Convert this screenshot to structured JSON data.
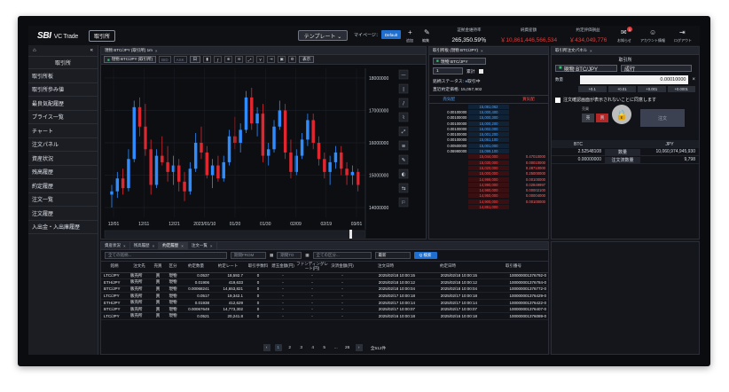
{
  "header": {
    "logo": "SBI",
    "logo_sub": "VC Trade",
    "mode_label": "取引所",
    "template_label": "テンプレート ⌄",
    "myseat_label": "マイページ：",
    "default_label": "Default",
    "add_label": "追加",
    "edit_label": "編集",
    "stats": [
      {
        "title": "証拠金維持率",
        "value": "265,350.59％",
        "color": "#ffffff"
      },
      {
        "title": "純資産額",
        "value": "￥10,861,446,566,534",
        "color": "#e23b3b"
      },
      {
        "title": "約定評価損益",
        "value": "￥434,049,776",
        "color": "#e23b3b"
      }
    ],
    "notice_label": "お知らせ",
    "notice_badge": "1",
    "account_label": "アカウント情報",
    "logout_label": "ログアウト"
  },
  "sidebar": {
    "title": "取引所",
    "items": [
      "取引所板",
      "取引所歩み値",
      "最良気配履歴",
      "プライス一覧",
      "チャート",
      "注文パネル",
      "資産状況",
      "残高履歴",
      "約定履歴",
      "注文一覧",
      "注文履歴",
      "入出金・入出庫履歴"
    ]
  },
  "chart_panel": {
    "tab": "現物 BTC/JPY (取引所) 1m",
    "pair": "現物 BTC/JPY (取引所)",
    "bid": "BID",
    "ask": "ASK",
    "interval": "日",
    "display": "表示"
  },
  "chart_data": {
    "type": "candlestick",
    "x_ticks": [
      "12/01",
      "12/11",
      "12/21",
      "2023/01/10",
      "01/20",
      "01/30",
      "02/09",
      "02/19",
      "03/01"
    ],
    "y_ticks": [
      18000000,
      17000000,
      16000000,
      15000000,
      14000000
    ],
    "ylim": [
      13700000,
      18300000
    ],
    "up_color": "#2f8cff",
    "down_color": "#e0272f",
    "candles": [
      {
        "o": 14400000,
        "h": 14700000,
        "l": 14000000,
        "c": 14500000
      },
      {
        "o": 14500000,
        "h": 15100000,
        "l": 14300000,
        "c": 14900000
      },
      {
        "o": 14900000,
        "h": 15200000,
        "l": 14400000,
        "c": 14600000
      },
      {
        "o": 14600000,
        "h": 15800000,
        "l": 14500000,
        "c": 15500000
      },
      {
        "o": 15500000,
        "h": 17300000,
        "l": 15400000,
        "c": 17100000
      },
      {
        "o": 17100000,
        "h": 17400000,
        "l": 16200000,
        "c": 16500000
      },
      {
        "o": 16500000,
        "h": 17200000,
        "l": 15600000,
        "c": 15800000
      },
      {
        "o": 15800000,
        "h": 16100000,
        "l": 14400000,
        "c": 14700000
      },
      {
        "o": 14700000,
        "h": 15800000,
        "l": 14600000,
        "c": 15600000
      },
      {
        "o": 15600000,
        "h": 16200000,
        "l": 15300000,
        "c": 15400000
      },
      {
        "o": 15400000,
        "h": 15900000,
        "l": 14800000,
        "c": 15100000
      },
      {
        "o": 15100000,
        "h": 15600000,
        "l": 14700000,
        "c": 15300000
      },
      {
        "o": 15300000,
        "h": 15500000,
        "l": 14500000,
        "c": 14800000
      },
      {
        "o": 14800000,
        "h": 15100000,
        "l": 14200000,
        "c": 14500000
      },
      {
        "o": 14500000,
        "h": 15400000,
        "l": 14400000,
        "c": 15200000
      },
      {
        "o": 15200000,
        "h": 16300000,
        "l": 15100000,
        "c": 16000000
      },
      {
        "o": 16000000,
        "h": 16500000,
        "l": 15500000,
        "c": 15700000
      },
      {
        "o": 15700000,
        "h": 15900000,
        "l": 14900000,
        "c": 15000000
      },
      {
        "o": 15000000,
        "h": 15500000,
        "l": 14600000,
        "c": 15300000
      },
      {
        "o": 15300000,
        "h": 15600000,
        "l": 14800000,
        "c": 14900000
      },
      {
        "o": 14900000,
        "h": 15600000,
        "l": 14800000,
        "c": 15400000
      },
      {
        "o": 15400000,
        "h": 16400000,
        "l": 15300000,
        "c": 16200000
      },
      {
        "o": 16200000,
        "h": 16800000,
        "l": 15800000,
        "c": 16000000
      },
      {
        "o": 16000000,
        "h": 16600000,
        "l": 15700000,
        "c": 16400000
      },
      {
        "o": 16400000,
        "h": 17600000,
        "l": 16300000,
        "c": 17400000
      },
      {
        "o": 17400000,
        "h": 17700000,
        "l": 16400000,
        "c": 16600000
      },
      {
        "o": 16600000,
        "h": 17100000,
        "l": 16200000,
        "c": 16900000
      },
      {
        "o": 16900000,
        "h": 17200000,
        "l": 15400000,
        "c": 15600000
      },
      {
        "o": 15600000,
        "h": 16000000,
        "l": 15300000,
        "c": 15800000
      },
      {
        "o": 15800000,
        "h": 16700000,
        "l": 15700000,
        "c": 16500000
      },
      {
        "o": 16500000,
        "h": 17300000,
        "l": 16400000,
        "c": 17000000
      },
      {
        "o": 17000000,
        "h": 17200000,
        "l": 15500000,
        "c": 15700000
      },
      {
        "o": 15700000,
        "h": 16100000,
        "l": 14900000,
        "c": 15100000
      },
      {
        "o": 15100000,
        "h": 15800000,
        "l": 15000000,
        "c": 15600000
      },
      {
        "o": 15600000,
        "h": 16300000,
        "l": 15500000,
        "c": 16100000
      },
      {
        "o": 16100000,
        "h": 16900000,
        "l": 15900000,
        "c": 16700000
      },
      {
        "o": 16700000,
        "h": 16900000,
        "l": 15800000,
        "c": 16000000
      },
      {
        "o": 16000000,
        "h": 16200000,
        "l": 15300000,
        "c": 15500000
      },
      {
        "o": 15500000,
        "h": 15700000,
        "l": 14900000,
        "c": 15100000
      },
      {
        "o": 15100000,
        "h": 15600000,
        "l": 14700000,
        "c": 15400000
      },
      {
        "o": 15400000,
        "h": 15900000,
        "l": 15200000,
        "c": 15700000
      },
      {
        "o": 15700000,
        "h": 15900000,
        "l": 15000000,
        "c": 15200000
      },
      {
        "o": 15200000,
        "h": 15400000,
        "l": 14700000,
        "c": 15000000
      },
      {
        "o": 15000000,
        "h": 15300000,
        "l": 14700000,
        "c": 15100000
      },
      {
        "o": 15100000,
        "h": 15200000,
        "l": 14500000,
        "c": 14700000
      }
    ]
  },
  "chart_side_tools": [
    "—",
    "|",
    "/",
    "⌇",
    "⤢",
    "≡",
    "✎",
    "◐",
    "⇆",
    "⚐"
  ],
  "orderbook": {
    "tab": "取引所板 (現物 BTC/JPY)",
    "pair": "現物 BTC/JPY",
    "qty": "1",
    "cumul": "累計",
    "status_label": "銘柄ステータス:",
    "status_value": "取引中",
    "price_label": "直近約定価格:",
    "price_value": "15,057,902",
    "sell_header": "売気配",
    "buy_header": "買気配",
    "asks": [
      {
        "price": "15,081,062",
        "qty": ""
      },
      {
        "price": "15,000,400",
        "qty": "0.00100000"
      },
      {
        "price": "15,000,300",
        "qty": "0.00100000"
      },
      {
        "price": "15,000,200",
        "qty": "0.00100000"
      },
      {
        "price": "15,002,000",
        "qty": "0.00100000"
      },
      {
        "price": "15,001,200",
        "qty": "0.00100000"
      },
      {
        "price": "15,061,100",
        "qty": "0.00100000"
      },
      {
        "price": "15,001,000",
        "qty": "0.00500000"
      },
      {
        "price": "15,099,100",
        "qty": "0.06990000"
      }
    ],
    "bids": [
      {
        "price": "15,044,000",
        "qty": "0.47010000"
      },
      {
        "price": "15,030,000",
        "qty": "0.00010000"
      },
      {
        "price": "15,020,000",
        "qty": "0.28710000"
      },
      {
        "price": "15,000,000",
        "qty": "0.25000000"
      },
      {
        "price": "14,999,000",
        "qty": "0.00100000"
      },
      {
        "price": "14,990,000",
        "qty": "0.02849997"
      },
      {
        "price": "14,980,000",
        "qty": "0.00002100"
      },
      {
        "price": "14,950,000",
        "qty": "0.00004000"
      },
      {
        "price": "14,900,000",
        "qty": "0.00100000"
      },
      {
        "price": "14,861,000",
        "qty": ""
      }
    ]
  },
  "order_panel": {
    "tab": "取引所注文パネル",
    "title": "取引所",
    "pair": "現物 BTC/JPY",
    "type": "成行",
    "qty_label": "数量",
    "qty_value": "0.00010000",
    "steps": [
      "+0.1",
      "+0.01",
      "+0.001",
      "+0.0001"
    ],
    "agree_text": "注文確認画面が表示されないことに同意します",
    "sell_label": "売",
    "buy_label": "買",
    "order_label": "注文",
    "side_label": "売買",
    "balance_cols": [
      "BTC",
      "JPY"
    ],
    "balance_rows": [
      {
        "left": "2.52548108",
        "mid": "数量",
        "right": "10,060,974,945,930"
      },
      {
        "left": "0.00000000",
        "mid": "注文済数量",
        "right": "9,798"
      }
    ]
  },
  "bottom": {
    "tabs": [
      "資産状況",
      "残高履歴",
      "約定履歴",
      "注文一覧"
    ],
    "active_tab": 2,
    "filter_pair": "全ての銘柄...",
    "date_from": "期間FROM",
    "date_to": "期間TO",
    "filter_kind": "全ての区分...",
    "filter_recent": "最新",
    "search_label": "Q 検索",
    "columns": [
      "銘柄",
      "注文先",
      "売買",
      "区分",
      "約定数量",
      "約定レート",
      "取引手数料",
      "建玉金額(円)",
      "ファンディングレート(円)",
      "決済金額(円)",
      "注文日時",
      "約定日時",
      "取引番号"
    ],
    "rows": [
      [
        "LTC/JPY",
        "販売所",
        "買",
        "現物",
        "0.0537",
        "18,592.7",
        "0",
        "-",
        "-",
        "-",
        "2025/02/18 10:00:15",
        "2025/02/18 10:00:15",
        "100000001376792-0"
      ],
      [
        "ETH/JPY",
        "販売所",
        "買",
        "現物",
        "0.01906",
        "419,633",
        "0",
        "-",
        "-",
        "-",
        "2025/02/18 10:00:12",
        "2025/02/18 10:00:12",
        "100000001376784-0"
      ],
      [
        "BTC/JPY",
        "販売所",
        "買",
        "現物",
        "0.00068241",
        "14,653,821",
        "0",
        "-",
        "-",
        "-",
        "2025/02/18 10:00:04",
        "2025/02/18 10:00:04",
        "100000001376772-0"
      ],
      [
        "LTC/JPY",
        "販売所",
        "買",
        "現物",
        "0.0517",
        "19,342.1",
        "0",
        "-",
        "-",
        "-",
        "2025/02/17 10:00:18",
        "2025/02/17 10:00:18",
        "100000001376429-0"
      ],
      [
        "ETH/JPY",
        "販売所",
        "買",
        "現物",
        "0.01938",
        "412,629",
        "0",
        "-",
        "-",
        "-",
        "2025/02/17 10:00:14",
        "2025/02/17 10:00:14",
        "100000001376422-0"
      ],
      [
        "BTC/JPY",
        "販売所",
        "買",
        "現物",
        "0.00067649",
        "14,773,302",
        "0",
        "-",
        "-",
        "-",
        "2025/02/17 10:00:07",
        "2025/02/17 10:00:07",
        "100000001376407-0"
      ],
      [
        "LTC/JPY",
        "販売所",
        "買",
        "現物",
        "0.0521",
        "20,241.8",
        "0",
        "-",
        "-",
        "-",
        "2025/02/16 10:00:18",
        "2025/02/16 10:00:18",
        "100000001376089-0"
      ]
    ],
    "pages": [
      "1",
      "2",
      "3",
      "4",
      "5",
      "...",
      "26"
    ],
    "total": "全512件"
  }
}
